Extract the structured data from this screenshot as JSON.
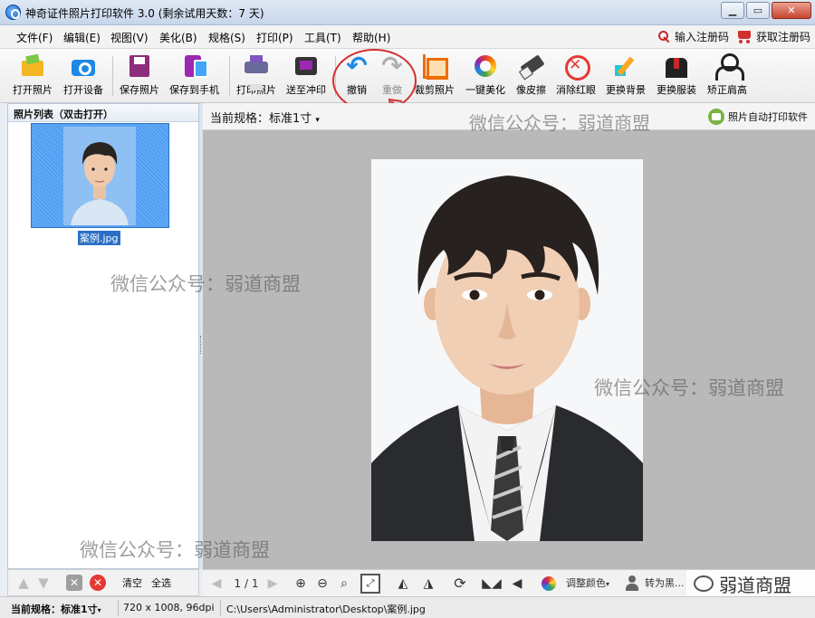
{
  "window": {
    "title": "神奇证件照片打印软件 3.0 (剩余试用天数：7 天)"
  },
  "menu": {
    "items": [
      "文件(F)",
      "编辑(E)",
      "视图(V)",
      "美化(B)",
      "规格(S)",
      "打印(P)",
      "工具(T)",
      "帮助(H)"
    ],
    "register_code": "输入注册码",
    "get_register_code": "获取注册码"
  },
  "toolbar": {
    "open_photo": "打开照片",
    "open_device": "打开设备",
    "save_photo": "保存照片",
    "save_to_phone": "保存到手机",
    "print_photo": "打印照片",
    "send_to_print": "送至冲印",
    "undo": "撤销",
    "redo": "重做",
    "crop_photo": "裁剪照片",
    "one_click_beautify": "一键美化",
    "eraser": "像皮擦",
    "remove_red_eye": "消除红眼",
    "change_background": "更换背景",
    "change_clothes": "更换服装",
    "fix_shoulders": "矫正肩高"
  },
  "photo_list": {
    "title": "照片列表（双击打开）",
    "items": [
      {
        "filename": "案例.jpg"
      }
    ],
    "clear": "清空",
    "select_all": "全选"
  },
  "canvas": {
    "current_spec": "当前规格：标准1寸",
    "auto_print_link": "照片自动打印软件",
    "page_indicator": "1 / 1",
    "adjust_color": "调整颜色",
    "convert_to": "转为黑..."
  },
  "watermarks": {
    "text": "微信公众号：弱道商盟",
    "brand": "弱道商盟"
  },
  "status": {
    "spec": "当前规格：标准1寸",
    "dimensions": "720 x 1008, 96dpi",
    "path": "C:\\Users\\Administrator\\Desktop\\案例.jpg"
  },
  "colors": {
    "accent_blue": "#1e88e5",
    "annotation_red": "#d32f2f",
    "selection_blue": "#4f9ef3"
  }
}
